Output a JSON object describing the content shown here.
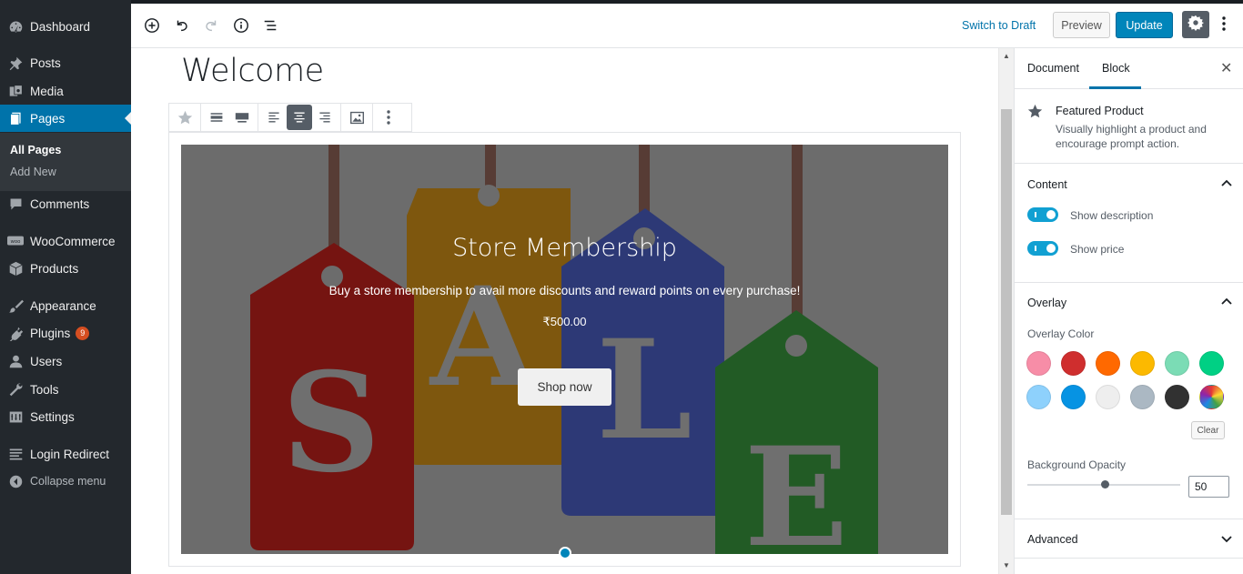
{
  "sidebar": {
    "items": [
      {
        "label": "Dashboard"
      },
      {
        "label": "Posts"
      },
      {
        "label": "Media"
      },
      {
        "label": "Pages"
      },
      {
        "label": "Comments"
      },
      {
        "label": "WooCommerce"
      },
      {
        "label": "Products"
      },
      {
        "label": "Appearance"
      },
      {
        "label": "Plugins",
        "badge": "9"
      },
      {
        "label": "Users"
      },
      {
        "label": "Tools"
      },
      {
        "label": "Settings"
      },
      {
        "label": "Login Redirect"
      },
      {
        "label": "Collapse menu"
      }
    ],
    "submenu": [
      {
        "label": "All Pages"
      },
      {
        "label": "Add New"
      }
    ],
    "active_color": "#0073aa"
  },
  "header": {
    "switch_to_draft": "Switch to Draft",
    "preview": "Preview",
    "update": "Update"
  },
  "editor": {
    "page_title": "Welcome",
    "featured_product": {
      "title": "Store Membership",
      "description": "Buy a store membership to avail more discounts and reward points on every purchase!",
      "price": "₹500.00",
      "button": "Shop now",
      "image_letters": [
        "S",
        "A",
        "L",
        "E"
      ],
      "tag_colors": [
        "#9c1b17",
        "#a87413",
        "#3c4d9e",
        "#2e7a32"
      ]
    }
  },
  "panel": {
    "tabs": [
      "Document",
      "Block"
    ],
    "active_tab": "Block",
    "block": {
      "name": "Featured Product",
      "description": "Visually highlight a product and encourage prompt action."
    },
    "content": {
      "title": "Content",
      "show_description": "Show description",
      "show_price": "Show price"
    },
    "overlay": {
      "title": "Overlay",
      "color_label": "Overlay Color",
      "colors": [
        "#f78da7",
        "#cf2e2e",
        "#ff6900",
        "#fcb900",
        "#7bdcb5",
        "#00d084",
        "#8ed1fc",
        "#0693e3",
        "#eeeeee",
        "#abb8c3",
        "#313131",
        "conic"
      ],
      "clear": "Clear",
      "opacity_label": "Background Opacity",
      "opacity_value": "50"
    },
    "advanced": {
      "title": "Advanced"
    }
  }
}
